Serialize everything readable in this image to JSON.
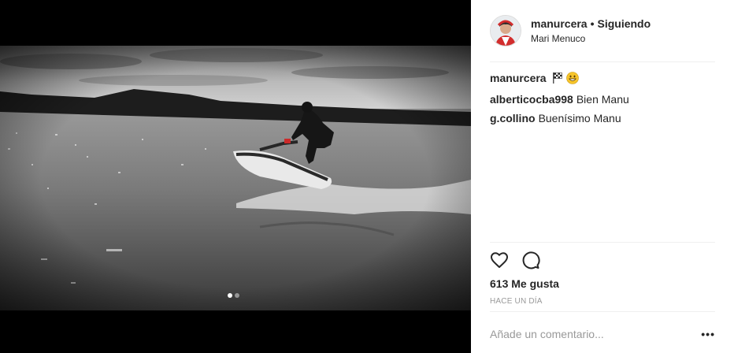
{
  "post": {
    "username": "manurcera",
    "follow_status": "Siguiendo",
    "separator": "•",
    "location": "Mari Menuco",
    "caption_user": "manurcera",
    "comments": [
      {
        "user": "alberticocba998",
        "text": "Bien Manu"
      },
      {
        "user": "g.collino",
        "text": "Buenísimo Manu"
      }
    ],
    "likes": "613 Me gusta",
    "time_ago": "HACE UN DÍA",
    "comment_placeholder": "Añade un comentario...",
    "more_label": "•••"
  },
  "media": {
    "carousel_index": 1,
    "carousel_count": 2
  },
  "icons": {
    "like": "heart-icon",
    "comment": "comment-icon",
    "caption_emoji_1": "checkered-flag-icon",
    "caption_emoji_2": "grinning-face-icon"
  }
}
